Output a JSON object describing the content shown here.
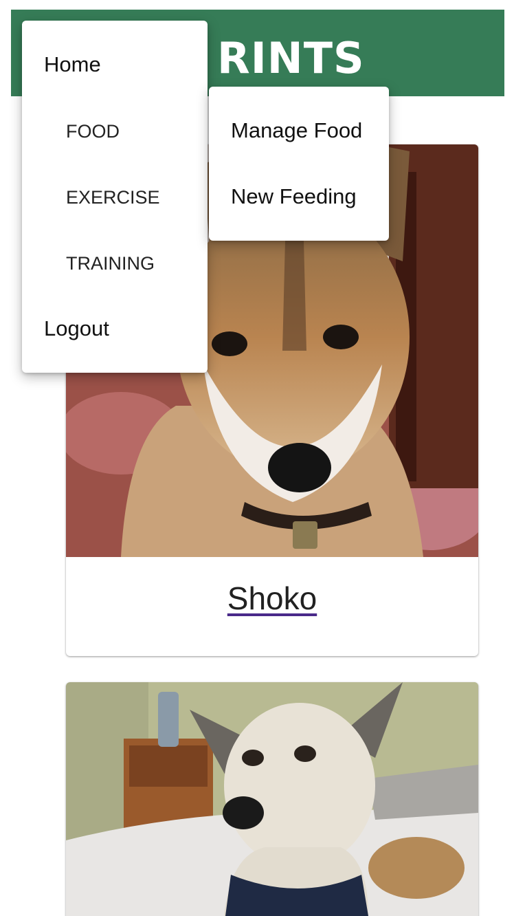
{
  "header": {
    "logo_text": "PRINTS",
    "visible_logo_text": "RINTS",
    "bg_color": "#367c57"
  },
  "menu": {
    "home": "Home",
    "items": [
      "FOOD",
      "EXERCISE",
      "TRAINING"
    ],
    "logout": "Logout"
  },
  "submenu": {
    "items": [
      "Manage Food",
      "New Feeding"
    ]
  },
  "pets": [
    {
      "name": "Shoko",
      "photo": "shiba-inu-dog-photo"
    },
    {
      "name": "",
      "photo": "white-dog-on-bed-photo"
    }
  ]
}
